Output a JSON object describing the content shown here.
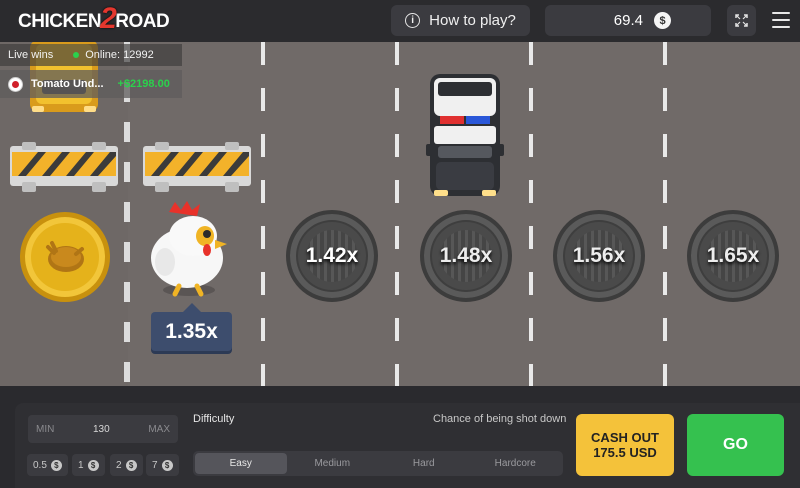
{
  "header": {
    "logo_left": "CHICKEN",
    "logo_mid": "2",
    "logo_right": "ROAD",
    "how_to_play": "How to play?",
    "balance": "69.4",
    "currency_icon": "$"
  },
  "live": {
    "label": "Live wins",
    "online": "Online: 12992",
    "player": "Tomato Und...",
    "amount": "+$2198.00"
  },
  "lanes": [
    {
      "multiplier": "1.42x"
    },
    {
      "multiplier": "1.48x"
    },
    {
      "multiplier": "1.56x"
    },
    {
      "multiplier": "1.65x"
    }
  ],
  "current_multiplier": "1.35x",
  "bet": {
    "min_label": "MIN",
    "amount": "130",
    "max_label": "MAX",
    "quick": [
      "0.5",
      "1",
      "2",
      "7"
    ],
    "coin_icon": "$"
  },
  "difficulty": {
    "label": "Difficulty",
    "chance_label": "Chance of being shot down",
    "tabs": [
      "Easy",
      "Medium",
      "Hard",
      "Hardcore"
    ],
    "selected": "Easy"
  },
  "cashout": {
    "line1": "CASH OUT",
    "line2": "175.5 USD"
  },
  "go_label": "GO",
  "colors": {
    "cashout": "#f4c23a",
    "go": "#35c14f",
    "win": "#2bd14c",
    "badge": "#3d4d6d"
  }
}
